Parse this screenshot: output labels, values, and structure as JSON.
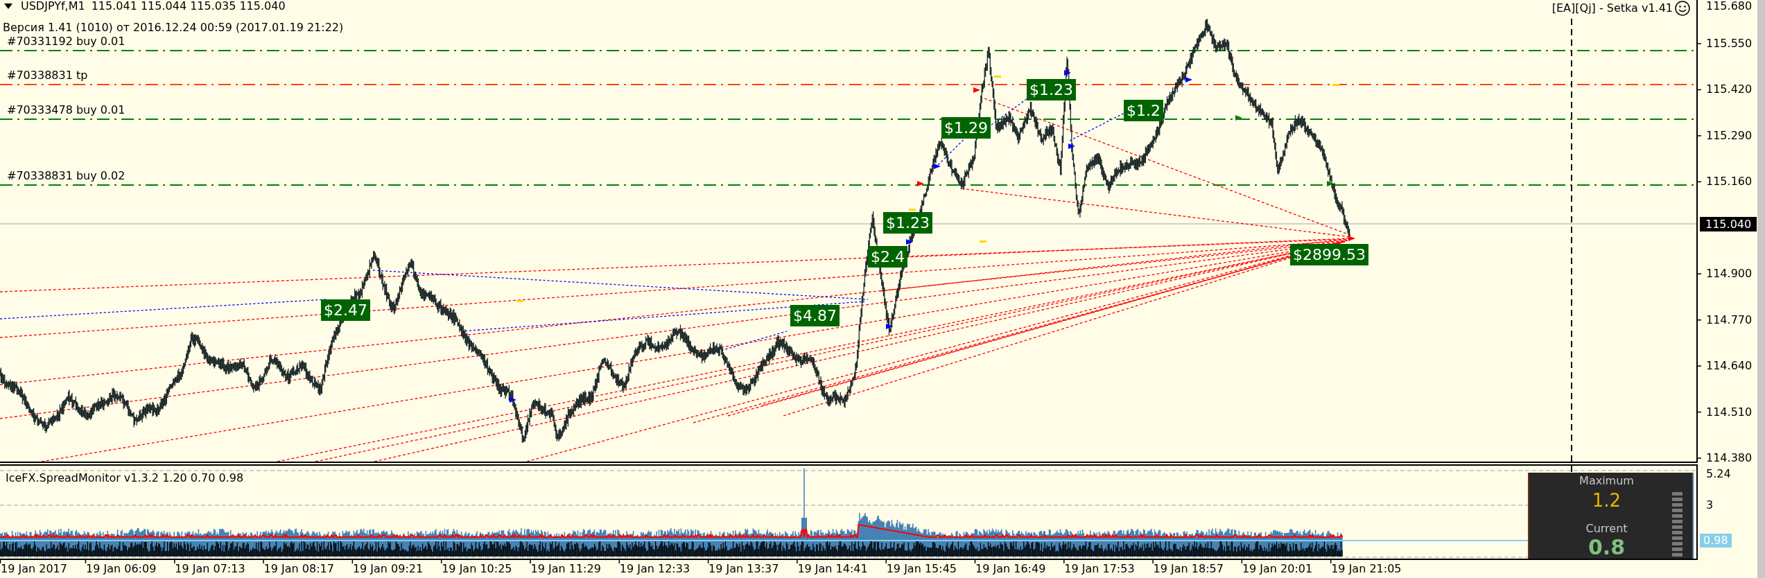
{
  "header": {
    "symbol": "USDJPYf,M1",
    "quotes": "115.041 115.044 115.035 115.040",
    "version": "Версия 1.41 (1010) от 2016.12.24 00:59 (2017.01.19 21:22)"
  },
  "expert": {
    "name": "[EA][Qj] - Setka v1.41"
  },
  "order_lines": [
    {
      "label": "#70331192 buy 0.01",
      "kind": "buy"
    },
    {
      "label": "#70338831 tp",
      "kind": "tp"
    },
    {
      "label": "#70333478 buy 0.01",
      "kind": "buy"
    },
    {
      "label": "#70338831 buy 0.02",
      "kind": "buy"
    }
  ],
  "profit_labels": [
    "$1.23",
    "$1.2",
    "$1.29",
    "$1.23",
    "$2899.53",
    "$2.4",
    "$2.47",
    "$4.87"
  ],
  "price_axis": {
    "labels": [
      "115.680",
      "115.550",
      "115.420",
      "115.290",
      "115.160",
      "114.900",
      "114.770",
      "114.640",
      "114.510",
      "114.380"
    ],
    "current": "115.040"
  },
  "spread_monitor": {
    "title": "IceFX.SpreadMonitor v1.3.2 1.20 0.70 0.98",
    "axis_labels": [
      "5.24",
      "3"
    ],
    "current_tag": "0.98",
    "maximum_label": "Maximum",
    "maximum_value": "1.2",
    "current_label": "Current",
    "current_value": "0.8"
  },
  "time_axis": [
    "19 Jan 2017",
    "19 Jan 06:09",
    "19 Jan 07:13",
    "19 Jan 08:17",
    "19 Jan 09:21",
    "19 Jan 10:25",
    "19 Jan 11:29",
    "19 Jan 12:33",
    "19 Jan 13:37",
    "19 Jan 14:41",
    "19 Jan 15:45",
    "19 Jan 16:49",
    "19 Jan 17:53",
    "19 Jan 18:57",
    "19 Jan 20:01",
    "19 Jan 21:05"
  ]
}
